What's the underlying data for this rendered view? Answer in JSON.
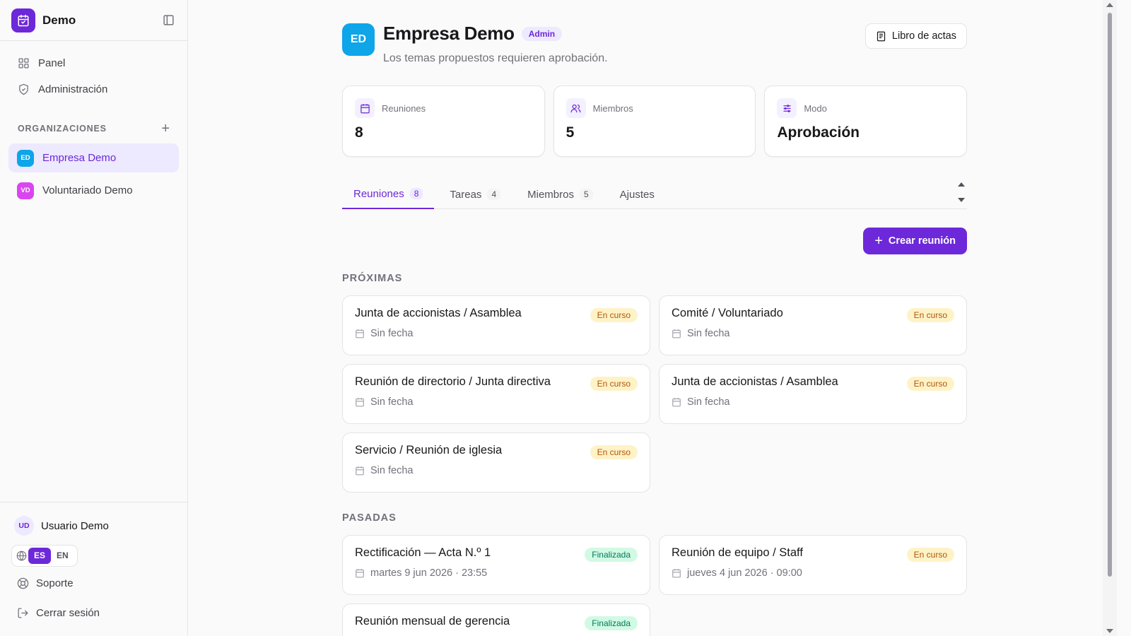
{
  "sidebar": {
    "app_name": "Demo",
    "nav": [
      {
        "label": "Panel",
        "icon": "grid-icon"
      },
      {
        "label": "Administración",
        "icon": "shield-icon"
      }
    ],
    "orgs_title": "ORGANIZACIONES",
    "orgs": [
      {
        "initials": "ED",
        "name": "Empresa Demo",
        "color": "#0ea5e9",
        "active": true
      },
      {
        "initials": "VD",
        "name": "Voluntariado Demo",
        "color": "#d946ef",
        "active": false
      }
    ],
    "user": {
      "initials": "UD",
      "name": "Usuario Demo"
    },
    "languages": [
      "ES",
      "EN"
    ],
    "support_label": "Soporte",
    "logout_label": "Cerrar sesión"
  },
  "header": {
    "initials": "ED",
    "title": "Empresa Demo",
    "role_badge": "Admin",
    "subtitle": "Los temas propuestos requieren aprobación.",
    "minutes_button": "Libro de actas"
  },
  "stats": [
    {
      "label": "Reuniones",
      "value": "8"
    },
    {
      "label": "Miembros",
      "value": "5"
    },
    {
      "label": "Modo",
      "value": "Aprobación"
    }
  ],
  "tabs": [
    {
      "label": "Reuniones",
      "count": "8"
    },
    {
      "label": "Tareas",
      "count": "4"
    },
    {
      "label": "Miembros",
      "count": "5"
    },
    {
      "label": "Ajustes",
      "count": ""
    }
  ],
  "create_button": "Crear reunión",
  "upcoming": {
    "title": "PRÓXIMAS",
    "items": [
      {
        "title": "Junta de accionistas / Asamblea",
        "date": "Sin fecha",
        "status": "En curso"
      },
      {
        "title": "Comité / Voluntariado",
        "date": "Sin fecha",
        "status": "En curso"
      },
      {
        "title": "Reunión de directorio / Junta directiva",
        "date": "Sin fecha",
        "status": "En curso"
      },
      {
        "title": "Junta de accionistas / Asamblea",
        "date": "Sin fecha",
        "status": "En curso"
      },
      {
        "title": "Servicio / Reunión de iglesia",
        "date": "Sin fecha",
        "status": "En curso"
      }
    ]
  },
  "past": {
    "title": "PASADAS",
    "items": [
      {
        "title": "Rectificación — Acta N.º 1",
        "date": "martes 9 jun 2026 · 23:55",
        "status": "Finalizada"
      },
      {
        "title": "Reunión de equipo / Staff",
        "date": "jueves 4 jun 2026 · 09:00",
        "status": "En curso"
      },
      {
        "title": "Reunión mensual de gerencia",
        "date": "",
        "status": "Finalizada"
      }
    ]
  },
  "colors": {
    "accent": "#6d28d9",
    "live": "#fef3c7",
    "done": "#d1fae5"
  }
}
